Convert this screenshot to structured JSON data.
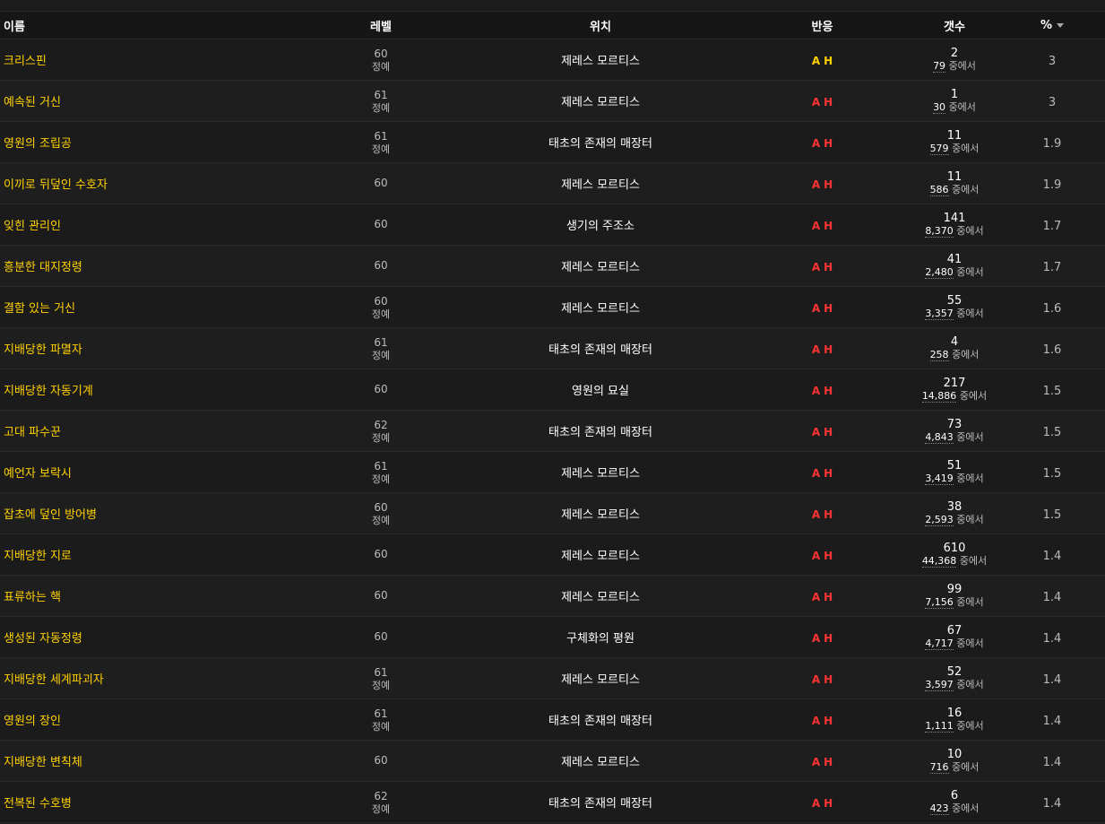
{
  "header": {
    "name": "이름",
    "level": "레벨",
    "location": "위치",
    "reaction": "반응",
    "count": "갯수",
    "percent": "%"
  },
  "colors": {
    "name": "#ffd100",
    "reaction_red": "#ff3333",
    "reaction_yellow": "#ffd100"
  },
  "rows": [
    {
      "name": "크리스핀",
      "level": "60",
      "tag": "정예",
      "location": "제레스 모르티스",
      "a": "A",
      "h": "H",
      "a_color": "#ffd100",
      "h_color": "#ffd100",
      "count": "2",
      "of": "79",
      "of_suffix": "중에서",
      "pct": "3"
    },
    {
      "name": "예속된 거신",
      "level": "61",
      "tag": "정예",
      "location": "제레스 모르티스",
      "a": "A",
      "h": "H",
      "a_color": "#ff3333",
      "h_color": "#ff3333",
      "count": "1",
      "of": "30",
      "of_suffix": "중에서",
      "pct": "3"
    },
    {
      "name": "영원의 조립공",
      "level": "61",
      "tag": "정예",
      "location": "태초의 존재의 매장터",
      "a": "A",
      "h": "H",
      "a_color": "#ff3333",
      "h_color": "#ff3333",
      "count": "11",
      "of": "579",
      "of_suffix": "중에서",
      "pct": "1.9"
    },
    {
      "name": "이끼로 뒤덮인 수호자",
      "level": "60",
      "tag": "",
      "location": "제레스 모르티스",
      "a": "A",
      "h": "H",
      "a_color": "#ff3333",
      "h_color": "#ff3333",
      "count": "11",
      "of": "586",
      "of_suffix": "중에서",
      "pct": "1.9"
    },
    {
      "name": "잊힌 관리인",
      "level": "60",
      "tag": "",
      "location": "생기의 주조소",
      "a": "A",
      "h": "H",
      "a_color": "#ff3333",
      "h_color": "#ff3333",
      "count": "141",
      "of": "8,370",
      "of_suffix": "중에서",
      "pct": "1.7"
    },
    {
      "name": "흥분한 대지정령",
      "level": "60",
      "tag": "",
      "location": "제레스 모르티스",
      "a": "A",
      "h": "H",
      "a_color": "#ff3333",
      "h_color": "#ff3333",
      "count": "41",
      "of": "2,480",
      "of_suffix": "중에서",
      "pct": "1.7"
    },
    {
      "name": "결함 있는 거신",
      "level": "60",
      "tag": "정예",
      "location": "제레스 모르티스",
      "a": "A",
      "h": "H",
      "a_color": "#ff3333",
      "h_color": "#ff3333",
      "count": "55",
      "of": "3,357",
      "of_suffix": "중에서",
      "pct": "1.6"
    },
    {
      "name": "지배당한 파멸자",
      "level": "61",
      "tag": "정예",
      "location": "태초의 존재의 매장터",
      "a": "A",
      "h": "H",
      "a_color": "#ff3333",
      "h_color": "#ff3333",
      "count": "4",
      "of": "258",
      "of_suffix": "중에서",
      "pct": "1.6"
    },
    {
      "name": "지배당한 자동기계",
      "level": "60",
      "tag": "",
      "location": "영원의 묘실",
      "a": "A",
      "h": "H",
      "a_color": "#ff3333",
      "h_color": "#ff3333",
      "count": "217",
      "of": "14,886",
      "of_suffix": "중에서",
      "pct": "1.5"
    },
    {
      "name": "고대 파수꾼",
      "level": "62",
      "tag": "정예",
      "location": "태초의 존재의 매장터",
      "a": "A",
      "h": "H",
      "a_color": "#ff3333",
      "h_color": "#ff3333",
      "count": "73",
      "of": "4,843",
      "of_suffix": "중에서",
      "pct": "1.5"
    },
    {
      "name": "예언자 보락시",
      "level": "61",
      "tag": "정예",
      "location": "제레스 모르티스",
      "a": "A",
      "h": "H",
      "a_color": "#ff3333",
      "h_color": "#ff3333",
      "count": "51",
      "of": "3,419",
      "of_suffix": "중에서",
      "pct": "1.5"
    },
    {
      "name": "잡초에 덮인 방어병",
      "level": "60",
      "tag": "정예",
      "location": "제레스 모르티스",
      "a": "A",
      "h": "H",
      "a_color": "#ff3333",
      "h_color": "#ff3333",
      "count": "38",
      "of": "2,593",
      "of_suffix": "중에서",
      "pct": "1.5"
    },
    {
      "name": "지배당한 지로",
      "level": "60",
      "tag": "",
      "location": "제레스 모르티스",
      "a": "A",
      "h": "H",
      "a_color": "#ff3333",
      "h_color": "#ff3333",
      "count": "610",
      "of": "44,368",
      "of_suffix": "중에서",
      "pct": "1.4"
    },
    {
      "name": "표류하는 핵",
      "level": "60",
      "tag": "",
      "location": "제레스 모르티스",
      "a": "A",
      "h": "H",
      "a_color": "#ff3333",
      "h_color": "#ff3333",
      "count": "99",
      "of": "7,156",
      "of_suffix": "중에서",
      "pct": "1.4"
    },
    {
      "name": "생성된 자동정령",
      "level": "60",
      "tag": "",
      "location": "구체화의 평원",
      "a": "A",
      "h": "H",
      "a_color": "#ff3333",
      "h_color": "#ff3333",
      "count": "67",
      "of": "4,717",
      "of_suffix": "중에서",
      "pct": "1.4"
    },
    {
      "name": "지배당한 세계파괴자",
      "level": "61",
      "tag": "정예",
      "location": "제레스 모르티스",
      "a": "A",
      "h": "H",
      "a_color": "#ff3333",
      "h_color": "#ff3333",
      "count": "52",
      "of": "3,597",
      "of_suffix": "중에서",
      "pct": "1.4"
    },
    {
      "name": "영원의 장인",
      "level": "61",
      "tag": "정예",
      "location": "태초의 존재의 매장터",
      "a": "A",
      "h": "H",
      "a_color": "#ff3333",
      "h_color": "#ff3333",
      "count": "16",
      "of": "1,111",
      "of_suffix": "중에서",
      "pct": "1.4"
    },
    {
      "name": "지배당한 변칙체",
      "level": "60",
      "tag": "",
      "location": "제레스 모르티스",
      "a": "A",
      "h": "H",
      "a_color": "#ff3333",
      "h_color": "#ff3333",
      "count": "10",
      "of": "716",
      "of_suffix": "중에서",
      "pct": "1.4"
    },
    {
      "name": "전복된 수호병",
      "level": "62",
      "tag": "정예",
      "location": "태초의 존재의 매장터",
      "a": "A",
      "h": "H",
      "a_color": "#ff3333",
      "h_color": "#ff3333",
      "count": "6",
      "of": "423",
      "of_suffix": "중에서",
      "pct": "1.4"
    }
  ]
}
